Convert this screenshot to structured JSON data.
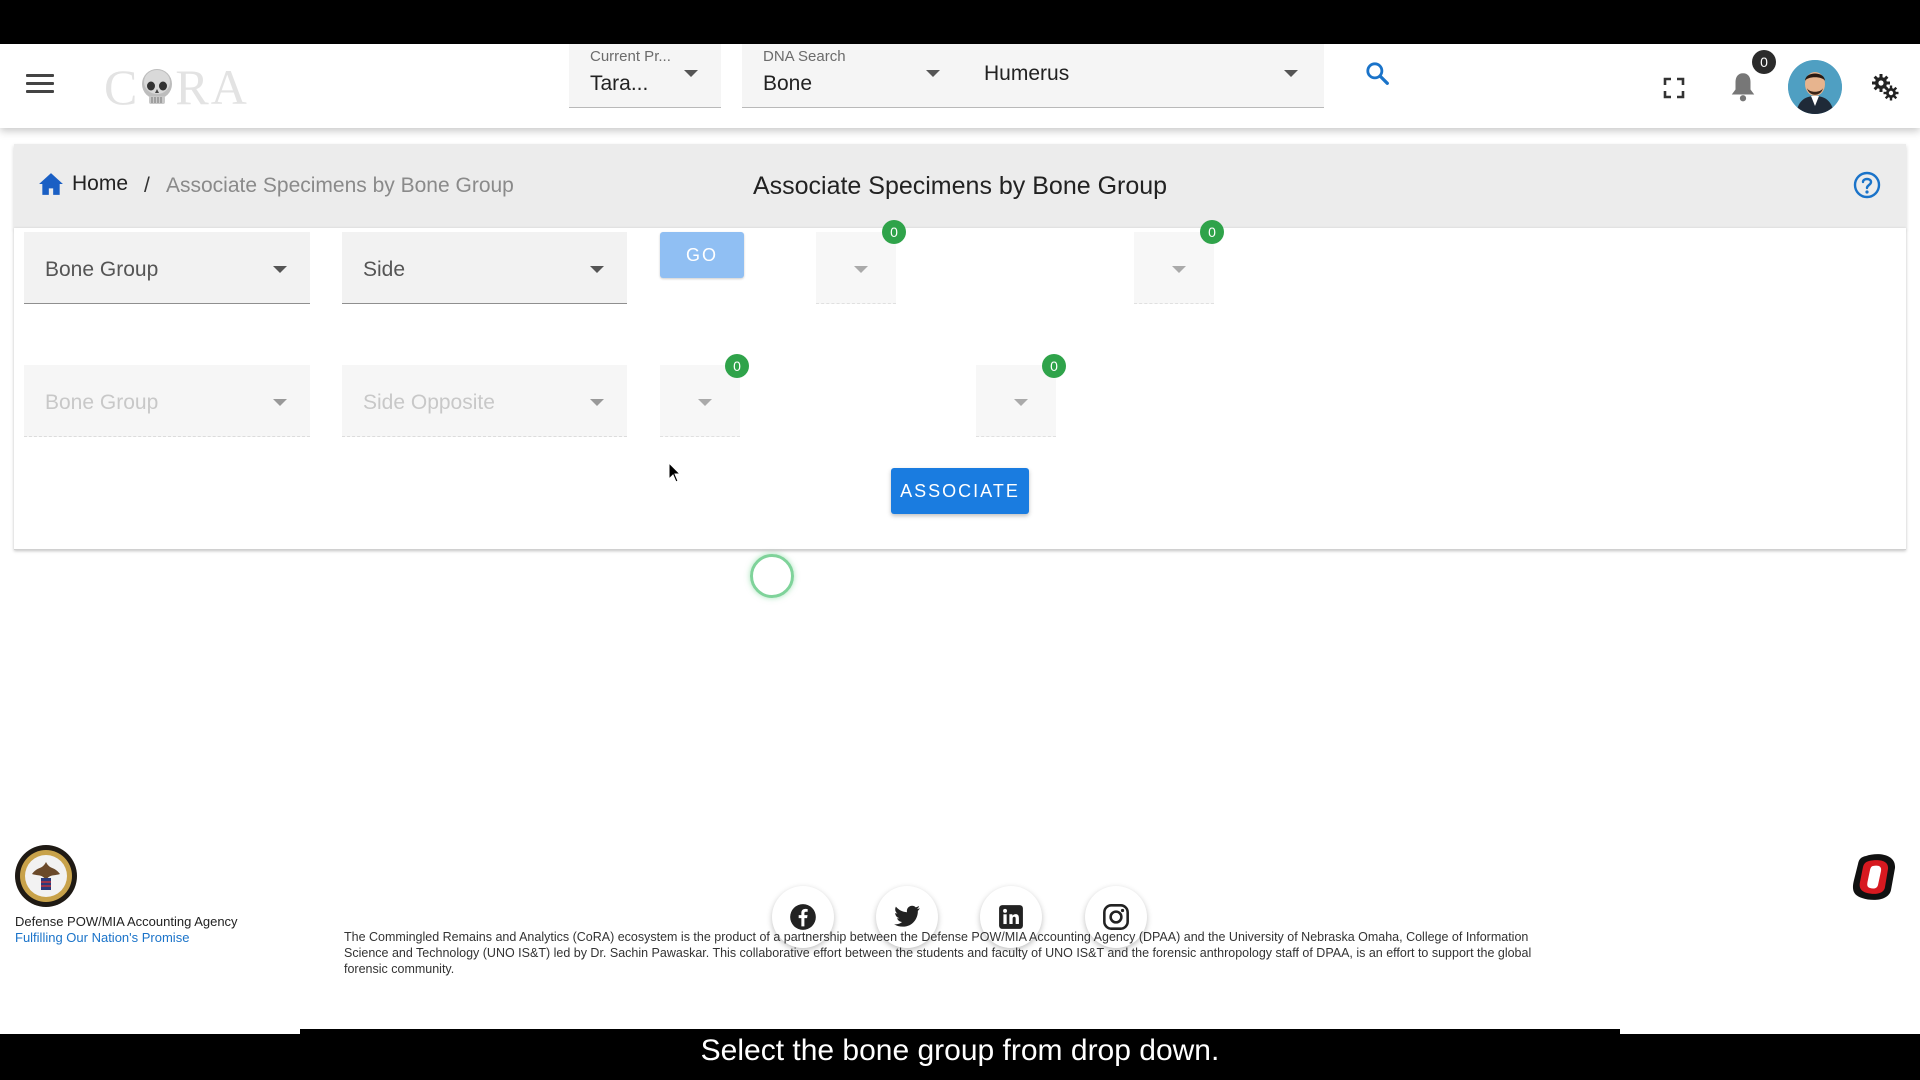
{
  "app": {
    "logo_text": "CORA",
    "project_select": {
      "label": "Current Pr...",
      "value": "Tara..."
    },
    "dna_select": {
      "label": "DNA Search",
      "value": "Bone"
    },
    "element_select": {
      "value": "Humerus"
    },
    "notification_count": "0",
    "icons": [
      "menu-icon",
      "search-icon",
      "fullscreen-icon",
      "bell-icon",
      "avatar",
      "settings-icon"
    ]
  },
  "breadcrumb": {
    "home": "Home",
    "separator": "/",
    "current": "Associate Specimens by Bone Group"
  },
  "page_title": "Associate Specimens by Bone Group",
  "form": {
    "row1": {
      "bone_group_placeholder": "Bone Group",
      "side_placeholder": "Side",
      "go_label": "GO",
      "badge_a": "0",
      "badge_b": "0"
    },
    "row2": {
      "bone_group_placeholder": "Bone Group",
      "side_placeholder": "Side Opposite",
      "badge_a": "0",
      "badge_b": "0"
    },
    "associate_label": "ASSOCIATE"
  },
  "footer": {
    "agency": "Defense POW/MIA Accounting Agency",
    "tagline": "Fulfilling Our Nation's Promise",
    "blurb": "The Commingled Remains and Analytics (CoRA) ecosystem is the product of a partnership between the Defense POW/MIA Accounting Agency (DPAA) and the University of Nebraska Omaha, College of Information Science and Technology (UNO IS&T) led by Dr. Sachin Pawaskar. This collaborative effort between the students and faculty of UNO IS&T and the forensic anthropology staff of DPAA, is an effort to support the global forensic community.",
    "social": [
      "facebook-icon",
      "twitter-icon",
      "linkedin-icon",
      "instagram-icon"
    ]
  },
  "caption": "Select the bone group from drop down.",
  "colors": {
    "primary": "#1a7ce0",
    "go_disabled": "#90bff3",
    "badge_green": "#2fa34a",
    "link": "#1a73c9"
  }
}
